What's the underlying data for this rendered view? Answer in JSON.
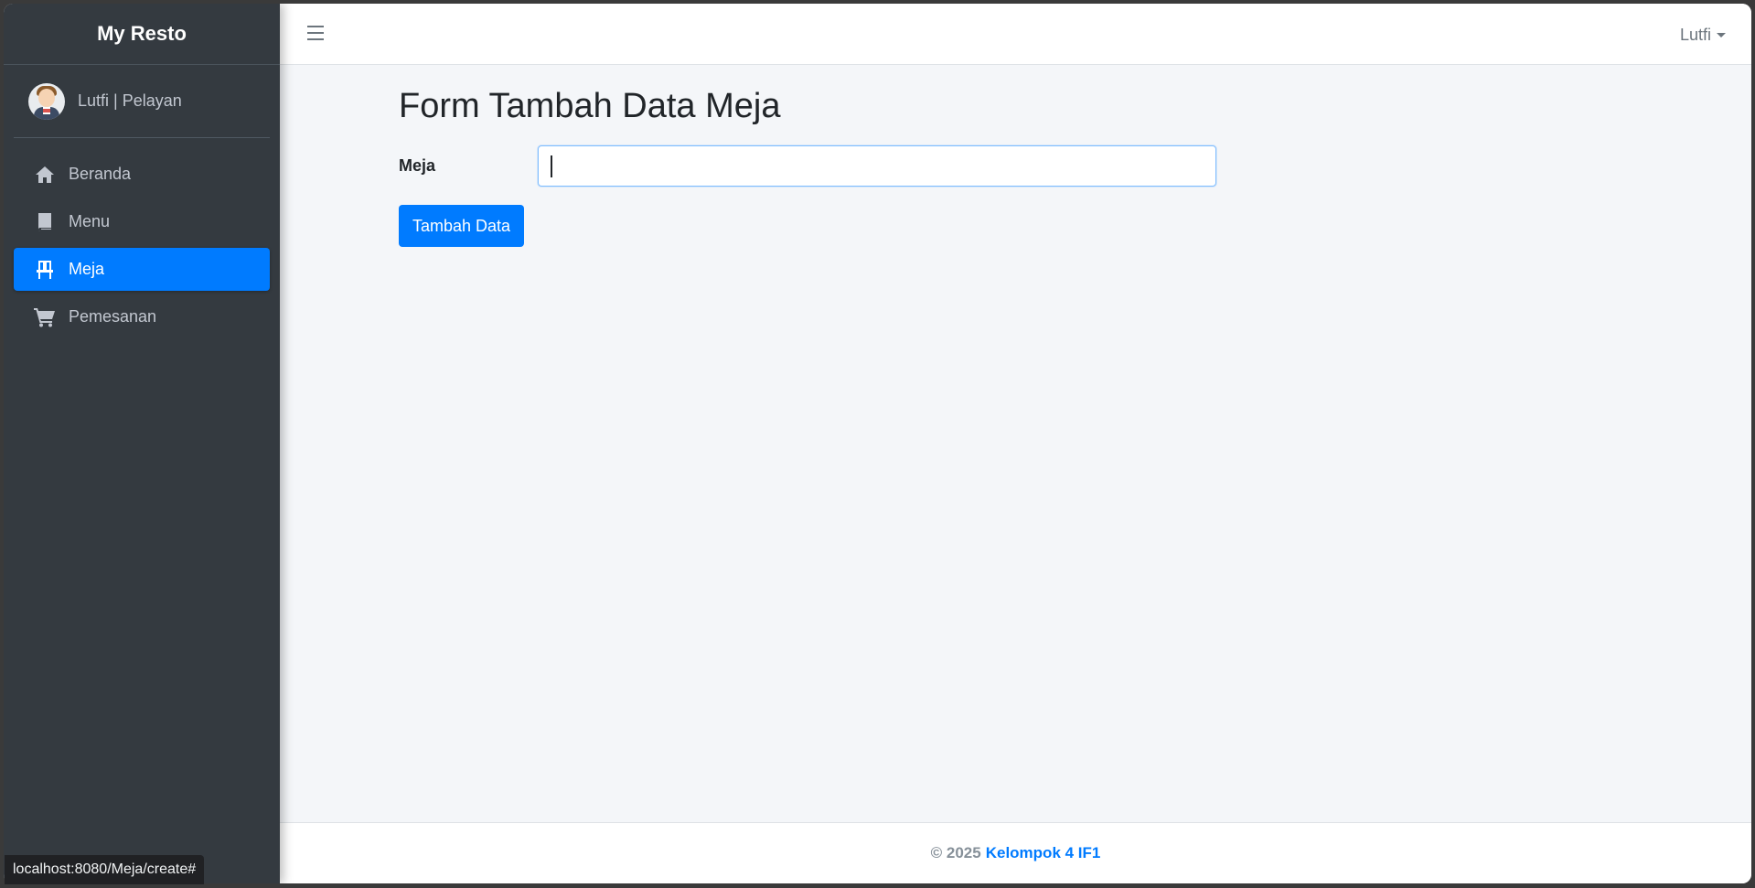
{
  "brand": "My Resto",
  "user_panel": {
    "name": "Lutfi | Pelayan"
  },
  "nav": [
    {
      "label": "Beranda",
      "icon": "home-icon",
      "active": false
    },
    {
      "label": "Menu",
      "icon": "book-icon",
      "active": false
    },
    {
      "label": "Meja",
      "icon": "chair-icon",
      "active": true
    },
    {
      "label": "Pemesanan",
      "icon": "cart-icon",
      "active": false
    }
  ],
  "navbar": {
    "user": "Lutfi"
  },
  "page": {
    "title": "Form Tambah Data Meja",
    "field_label": "Meja",
    "field_value": "",
    "submit_label": "Tambah Data"
  },
  "footer": {
    "prefix": "© 2025",
    "link": "Kelompok 4 IF1"
  },
  "status_url": "localhost:8080/Meja/create#",
  "colors": {
    "primary": "#007bff",
    "sidebar": "#343a40"
  }
}
